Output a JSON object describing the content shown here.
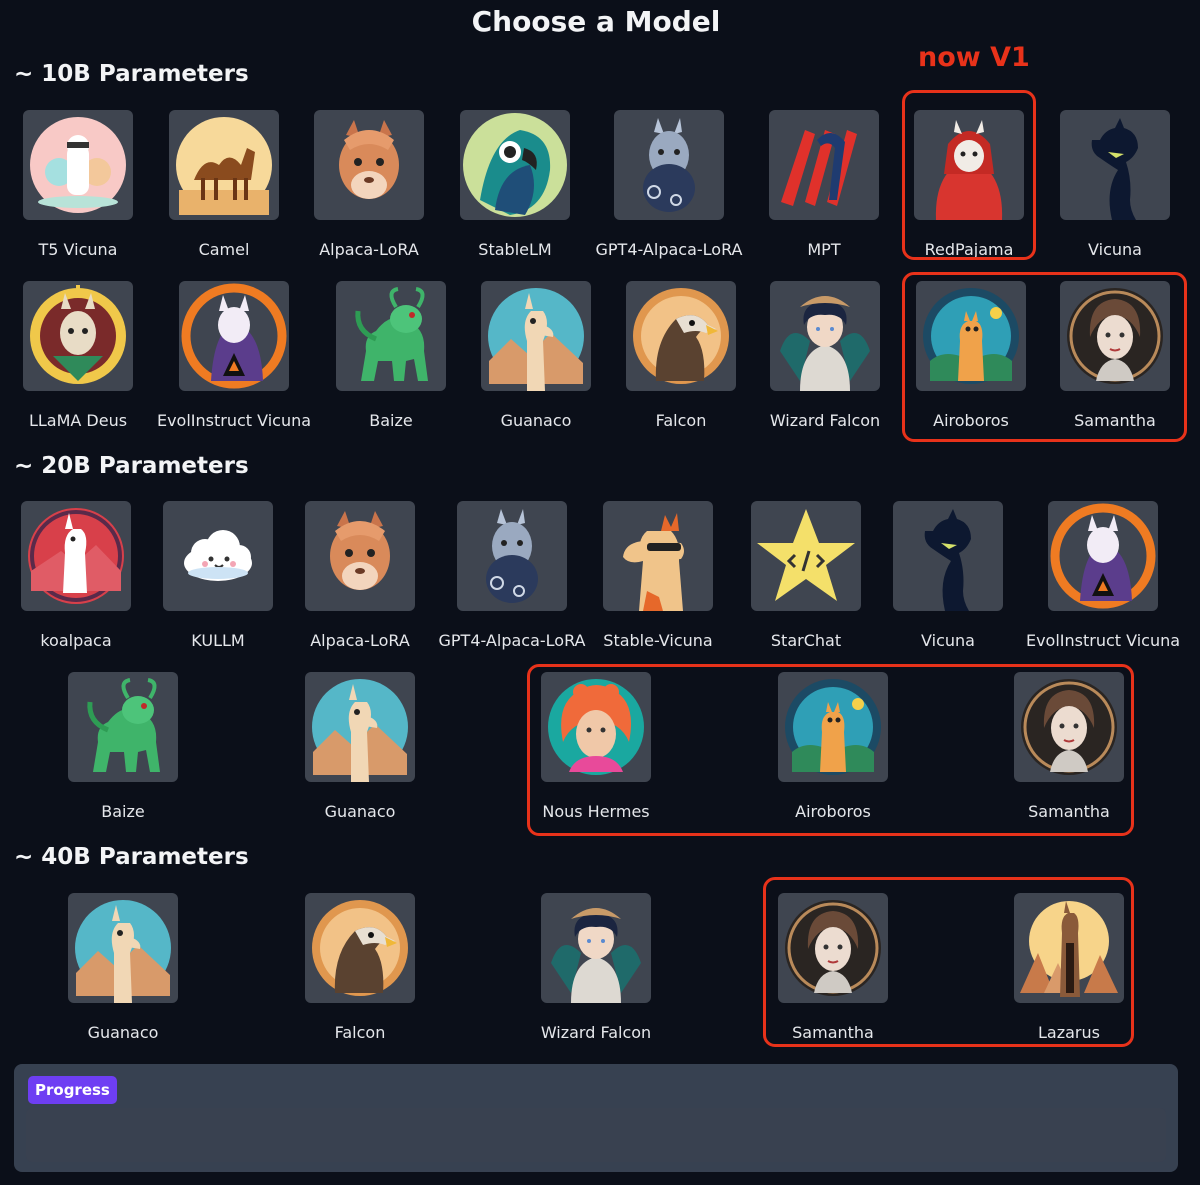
{
  "title": "Choose a Model",
  "annotation": {
    "text": "now V1",
    "color": "#e8321a"
  },
  "sections": {
    "s10": {
      "title": "~ 10B Parameters",
      "models": [
        "T5 Vicuna",
        "Camel",
        "Alpaca-LoRA",
        "StableLM",
        "GPT4-Alpaca-LoRA",
        "MPT",
        "RedPajama",
        "Vicuna",
        "LLaMA Deus",
        "EvolInstruct Vicuna",
        "Baize",
        "Guanaco",
        "Falcon",
        "Wizard Falcon",
        "Airoboros",
        "Samantha"
      ]
    },
    "s20": {
      "title": "~ 20B Parameters",
      "models": [
        "koalpaca",
        "KULLM",
        "Alpaca-LoRA",
        "GPT4-Alpaca-LoRA",
        "Stable-Vicuna",
        "StarChat",
        "Vicuna",
        "EvolInstruct Vicuna",
        "Baize",
        "Guanaco",
        "Nous Hermes",
        "Airoboros",
        "Samantha"
      ]
    },
    "s40": {
      "title": "~ 40B Parameters",
      "models": [
        "Guanaco",
        "Falcon",
        "Wizard Falcon",
        "Samantha",
        "Lazarus"
      ]
    }
  },
  "progress": {
    "label": "Progress"
  },
  "colors": {
    "background": "#0b0f19",
    "card": "#3f4550",
    "panel": "#374151",
    "badge": "#6e3ef3"
  }
}
